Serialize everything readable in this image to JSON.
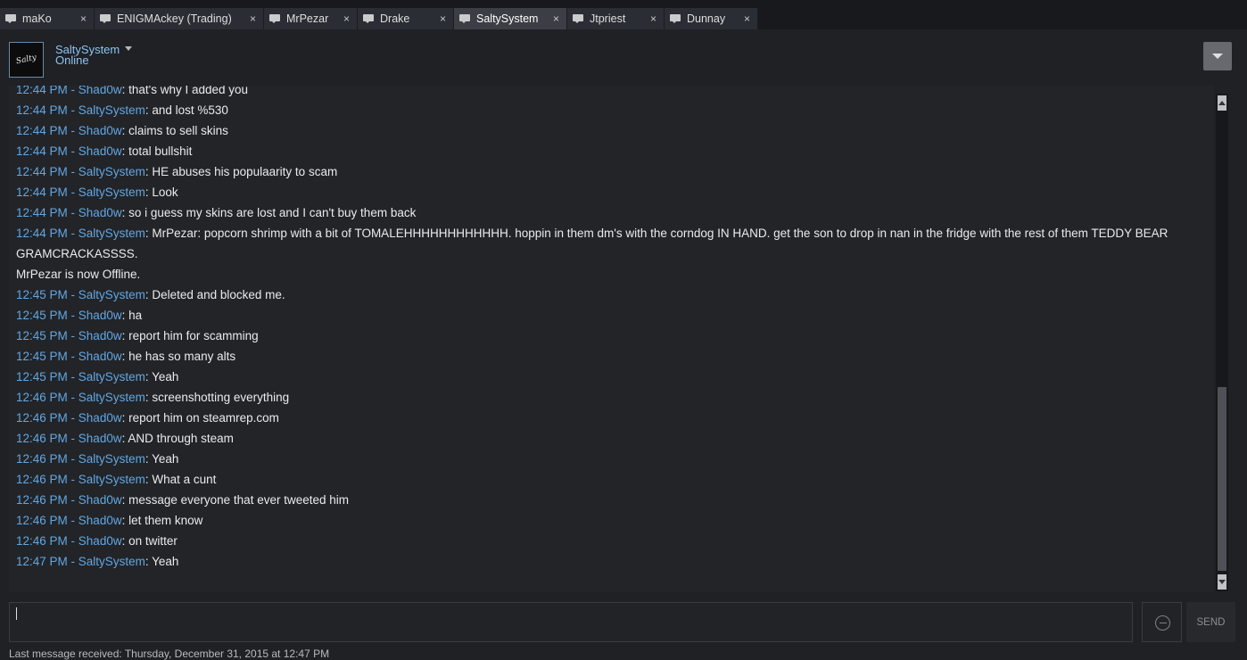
{
  "tabs": [
    {
      "label": "maKo",
      "close": "×",
      "active": false
    },
    {
      "label": "ENIGMAckey (Trading)",
      "close": "×",
      "active": false
    },
    {
      "label": "MrPezar",
      "close": "×",
      "active": false
    },
    {
      "label": "Drake",
      "close": "×",
      "active": false
    },
    {
      "label": "SaltySystem",
      "close": "×",
      "active": true
    },
    {
      "label": "Jtpriest",
      "close": "×",
      "active": false
    },
    {
      "label": "Dunnay",
      "close": "×",
      "active": false
    }
  ],
  "user": {
    "name": "SaltySystem",
    "status": "Online",
    "avatar_text": "Salty"
  },
  "chat": [
    {
      "ts": "12:44 PM",
      "sender": "Shad0w",
      "text": "that's why I added you"
    },
    {
      "ts": "12:44 PM",
      "sender": "SaltySystem",
      "text": "and lost %530"
    },
    {
      "ts": "12:44 PM",
      "sender": "Shad0w",
      "text": "claims to sell skins"
    },
    {
      "ts": "12:44 PM",
      "sender": "Shad0w",
      "text": "total bullshit"
    },
    {
      "ts": "12:44 PM",
      "sender": "SaltySystem",
      "text": "HE abuses his populaarity to scam"
    },
    {
      "ts": "12:44 PM",
      "sender": "SaltySystem",
      "text": "Look"
    },
    {
      "ts": "12:44 PM",
      "sender": "Shad0w",
      "text": "so i guess my skins are lost and I can't buy them back"
    },
    {
      "ts": "12:44 PM",
      "sender": "SaltySystem",
      "text": "MrPezar: popcorn shrimp with a bit of TOMALEHHHHHHHHHHHH. hoppin in them dm's with the corndog IN HAND. get the son to drop in nan in the fridge with the rest of them TEDDY BEAR GRAMCRACKASSSS."
    },
    {
      "status": "MrPezar is now Offline."
    },
    {
      "ts": "12:45 PM",
      "sender": "SaltySystem",
      "text": "Deleted and blocked me."
    },
    {
      "ts": "12:45 PM",
      "sender": "Shad0w",
      "text": "ha"
    },
    {
      "ts": "12:45 PM",
      "sender": "Shad0w",
      "text": "report him for scamming"
    },
    {
      "ts": "12:45 PM",
      "sender": "Shad0w",
      "text": "he has so many alts"
    },
    {
      "ts": "12:45 PM",
      "sender": "SaltySystem",
      "text": "Yeah"
    },
    {
      "ts": "12:46 PM",
      "sender": "SaltySystem",
      "text": "screenshotting everything"
    },
    {
      "ts": "12:46 PM",
      "sender": "Shad0w",
      "text": "report him on steamrep.com"
    },
    {
      "ts": "12:46 PM",
      "sender": "Shad0w",
      "text": "AND through steam"
    },
    {
      "ts": "12:46 PM",
      "sender": "SaltySystem",
      "text": "Yeah"
    },
    {
      "ts": "12:46 PM",
      "sender": "SaltySystem",
      "text": "What a cunt"
    },
    {
      "ts": "12:46 PM",
      "sender": "Shad0w",
      "text": "message everyone that ever tweeted him"
    },
    {
      "ts": "12:46 PM",
      "sender": "Shad0w",
      "text": "let them know"
    },
    {
      "ts": "12:46 PM",
      "sender": "Shad0w",
      "text": "on twitter"
    },
    {
      "ts": "12:47 PM",
      "sender": "SaltySystem",
      "text": "Yeah"
    }
  ],
  "composer": {
    "value": "",
    "send_label": "SEND"
  },
  "footer": {
    "last_message": "Last message received: Thursday, December 31, 2015 at 12:47 PM"
  },
  "icons": {
    "tab": "chat-bubble-icon",
    "emoji": "emoticon-icon",
    "menu": "dropdown-arrow-icon"
  },
  "colors": {
    "link_blue": "#62a7e3",
    "name_blue": "#8dc3f2",
    "text": "#ebebeb",
    "background": "#1f2125"
  }
}
